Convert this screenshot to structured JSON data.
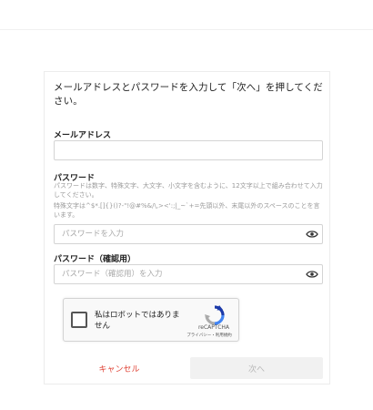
{
  "form": {
    "intro": "メールアドレスとパスワードを入力して「次へ」を押してください。",
    "email": {
      "label": "メールアドレス",
      "value": "",
      "placeholder": ""
    },
    "password": {
      "label": "パスワード",
      "help_1": "パスワードは数字、特殊文字、大文字、小文字を含むように、12文字以上で組み合わせて入力してください。",
      "help_2": "特殊文字は^$*.[]{}()?-\"!@#%&/\\,><':;|_~`+=先頭以外、末尾以外のスペースのことを言います。",
      "placeholder": "パスワードを入力",
      "eye_icon": "eye-icon"
    },
    "password_confirm": {
      "label": "パスワード（確認用）",
      "placeholder": "パスワード（確認用）を入力",
      "eye_icon": "eye-icon"
    },
    "captcha": {
      "label": "私はロボットではありません",
      "brand": "reCAPTCHA",
      "links": "プライバシー・利用規約",
      "logo_icon": "recaptcha-logo-icon"
    },
    "cancel_label": "キャンセル",
    "next_label": "次へ"
  },
  "colors": {
    "cancel": "#e0473a",
    "next_bg_disabled": "#f1f1f1",
    "next_text_disabled": "#b8b8b8",
    "help_text": "#9a9a9a",
    "border": "#d4d4d4"
  }
}
